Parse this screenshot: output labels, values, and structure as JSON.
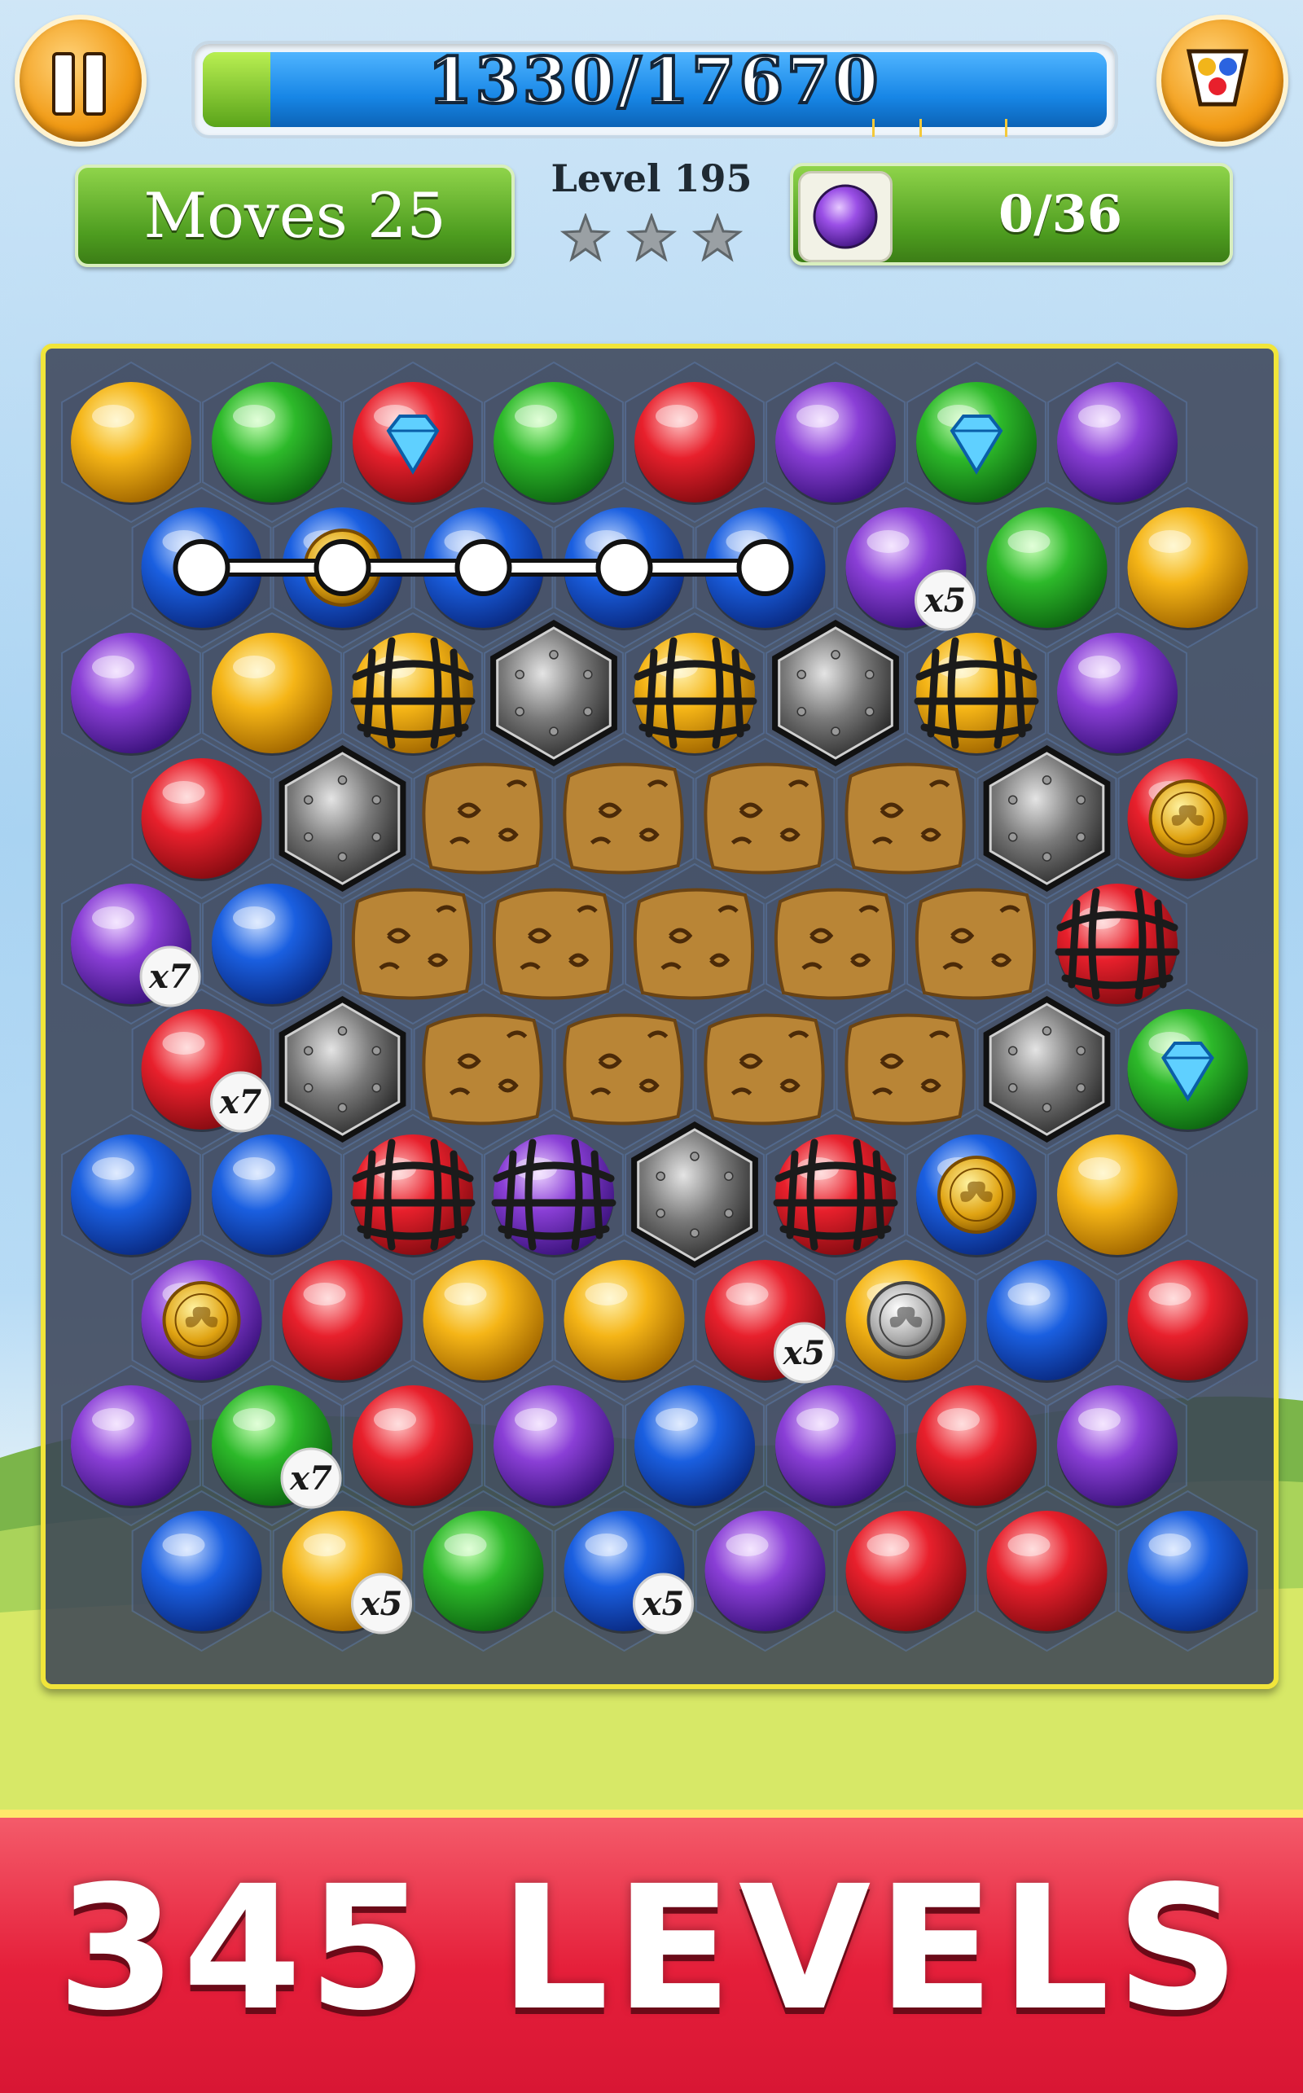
{
  "hud": {
    "score": "1330/17670",
    "score_progress": 0.075,
    "moves_text": "Moves 25",
    "level_text": "Level 195",
    "stars_earned": 0,
    "stars_total": 3,
    "goal_text": "0/36",
    "goal_color": "purple"
  },
  "board": {
    "rows": 10,
    "cols": 9,
    "colors": {
      "yellow": "#f5b517",
      "green": "#2db92a",
      "red": "#e8202c",
      "blue": "#1a5fe0",
      "purple": "#8a3fd6"
    },
    "cells": [
      [
        {
          "c": "yellow"
        },
        {
          "c": "green"
        },
        {
          "c": "red",
          "item": "diamond"
        },
        {
          "c": "green"
        },
        {
          "c": "red"
        },
        {
          "c": "purple"
        },
        {
          "c": "green",
          "item": "diamond"
        },
        {
          "c": "purple"
        }
      ],
      [
        {
          "c": "blue"
        },
        {
          "c": "blue",
          "item": "coin-gold"
        },
        {
          "c": "blue"
        },
        {
          "c": "blue"
        },
        {
          "c": "blue"
        },
        {
          "c": "purple",
          "badge": "x5"
        },
        {
          "c": "green"
        },
        {
          "c": "yellow"
        }
      ],
      [
        {
          "c": "purple"
        },
        {
          "c": "yellow"
        },
        {
          "c": "yellow",
          "item": "cage"
        },
        {
          "t": "rock"
        },
        {
          "c": "yellow",
          "item": "cage"
        },
        {
          "t": "rock"
        },
        {
          "c": "yellow",
          "item": "cage"
        },
        {
          "c": "purple"
        }
      ],
      [
        {
          "c": "red"
        },
        {
          "t": "rock"
        },
        {
          "t": "crate"
        },
        {
          "t": "crate"
        },
        {
          "t": "crate"
        },
        {
          "t": "crate"
        },
        {
          "t": "rock"
        },
        {
          "c": "red",
          "item": "coin-gold"
        }
      ],
      [
        {
          "c": "purple",
          "badge": "x7"
        },
        {
          "c": "blue"
        },
        {
          "t": "crate"
        },
        {
          "t": "crate"
        },
        {
          "t": "crate"
        },
        {
          "t": "crate"
        },
        {
          "t": "crate"
        },
        {
          "c": "red",
          "item": "cage"
        }
      ],
      [
        {
          "c": "red",
          "badge": "x7"
        },
        {
          "t": "rock"
        },
        {
          "t": "crate"
        },
        {
          "t": "crate"
        },
        {
          "t": "crate"
        },
        {
          "t": "crate"
        },
        {
          "t": "rock"
        },
        {
          "c": "green",
          "item": "diamond"
        }
      ],
      [
        {
          "c": "blue"
        },
        {
          "c": "blue"
        },
        {
          "c": "red",
          "item": "cage"
        },
        {
          "c": "purple",
          "item": "cage"
        },
        {
          "t": "rock"
        },
        {
          "c": "red",
          "item": "cage"
        },
        {
          "c": "blue",
          "item": "coin-gold"
        },
        {
          "c": "yellow"
        }
      ],
      [
        {
          "c": "purple",
          "item": "coin-gold"
        },
        {
          "c": "red"
        },
        {
          "c": "yellow"
        },
        {
          "c": "yellow"
        },
        {
          "c": "red",
          "badge": "x5"
        },
        {
          "c": "yellow",
          "item": "coin-silver"
        },
        {
          "c": "blue"
        },
        {
          "c": "red"
        }
      ],
      [
        {
          "c": "purple"
        },
        {
          "c": "green",
          "badge": "x7"
        },
        {
          "c": "red"
        },
        {
          "c": "purple"
        },
        {
          "c": "blue"
        },
        {
          "c": "purple"
        },
        {
          "c": "red"
        },
        {
          "c": "purple"
        }
      ],
      [
        {
          "c": "blue"
        },
        {
          "c": "yellow",
          "badge": "x5"
        },
        {
          "c": "green"
        },
        {
          "c": "blue",
          "badge": "x5"
        },
        {
          "c": "purple"
        },
        {
          "c": "red"
        },
        {
          "c": "red"
        },
        {
          "c": "blue"
        }
      ]
    ],
    "hint_path": {
      "row": 1,
      "from_col": 0,
      "to_col": 4
    }
  },
  "banner": {
    "text": "345 LEVELS"
  }
}
